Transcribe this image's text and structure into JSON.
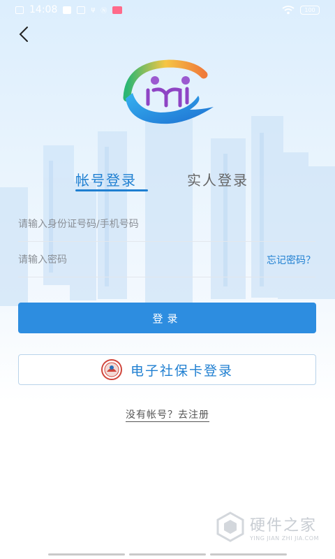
{
  "status_bar": {
    "time": "14:08",
    "net_label": "Ⓝ",
    "battery": "100"
  },
  "tabs": {
    "account_login": "帐号登录",
    "face_login": "实人登录"
  },
  "form": {
    "id_placeholder": "请输入身份证号码/手机号码",
    "password_placeholder": "请输入密码",
    "forgot_password": "忘记密码？"
  },
  "buttons": {
    "login": "登录",
    "social_card_login": "电子社保卡登录"
  },
  "register": {
    "text": "没有帐号？去注册"
  },
  "watermark": {
    "title": "硬件之家",
    "subtitle": "YING JIAN ZHI JIA.COM"
  },
  "colors": {
    "accent": "#1f7fd1",
    "button": "#2d8de0"
  }
}
